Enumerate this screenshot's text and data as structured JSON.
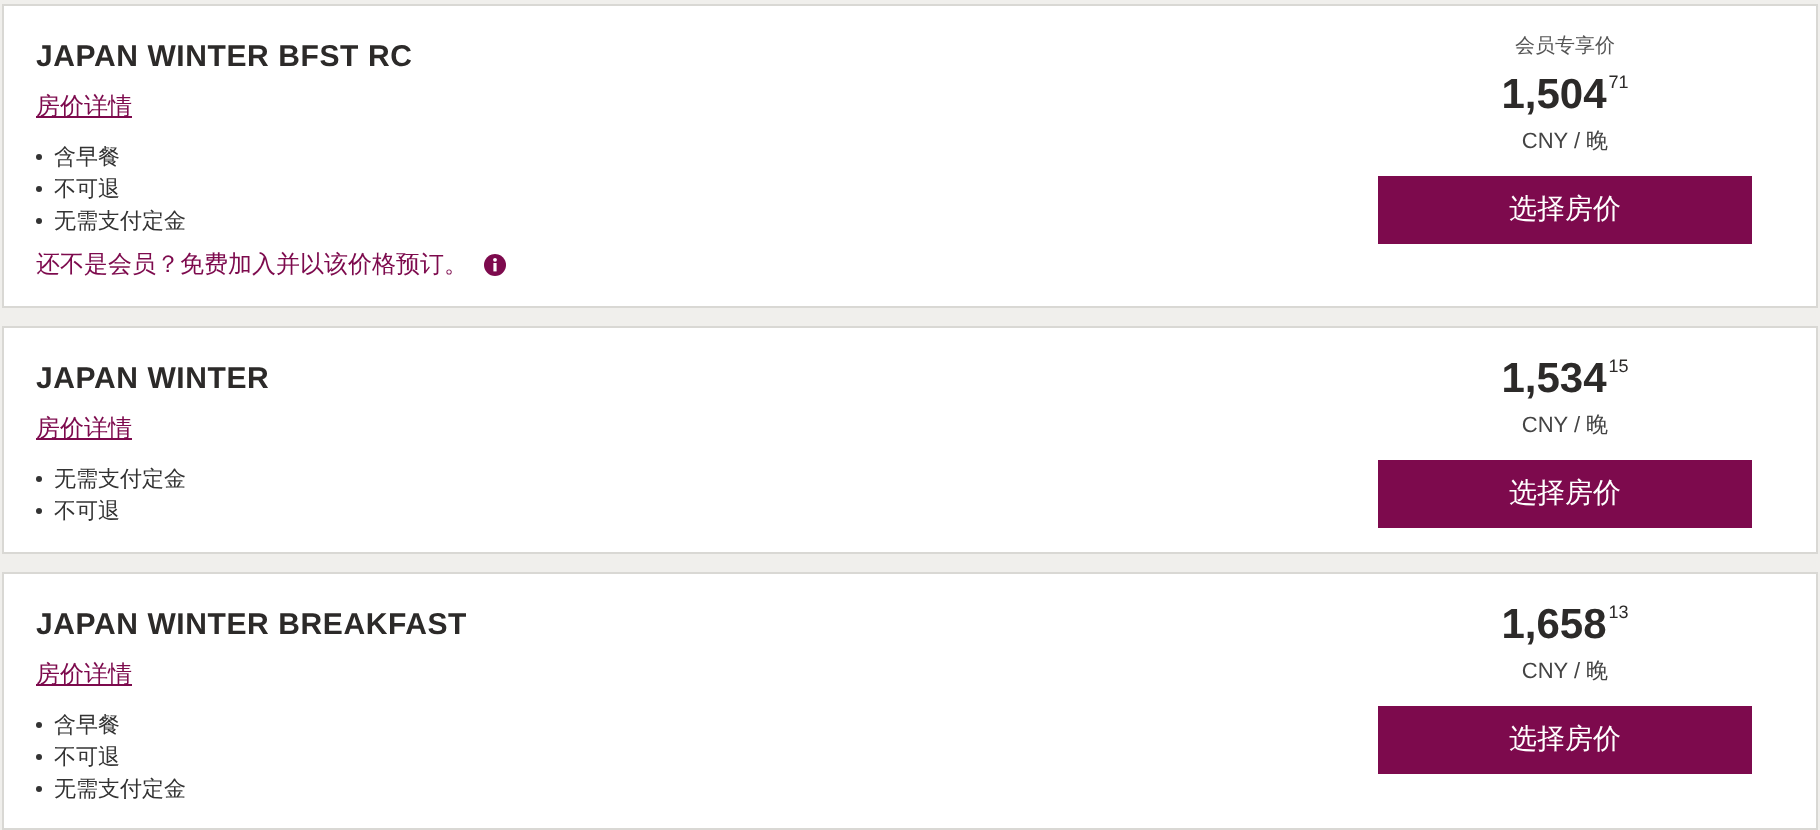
{
  "rates": [
    {
      "name": "JAPAN WINTER BFST RC",
      "details_link": "房价详情",
      "features": [
        "含早餐",
        "不可退",
        "无需支付定金"
      ],
      "member_note": "还不是会员？免费加入并以该价格预订。",
      "price_label": "会员专享价",
      "price": "1,504",
      "price_fraction": "71",
      "unit": "CNY / 晚",
      "button": "选择房价"
    },
    {
      "name": "JAPAN WINTER",
      "details_link": "房价详情",
      "features": [
        "无需支付定金",
        "不可退"
      ],
      "price": "1,534",
      "price_fraction": "15",
      "unit": "CNY / 晚",
      "button": "选择房价"
    },
    {
      "name": "JAPAN WINTER BREAKFAST",
      "details_link": "房价详情",
      "features": [
        "含早餐",
        "不可退",
        "无需支付定金"
      ],
      "price": "1,658",
      "price_fraction": "13",
      "unit": "CNY / 晚",
      "button": "选择房价"
    }
  ]
}
